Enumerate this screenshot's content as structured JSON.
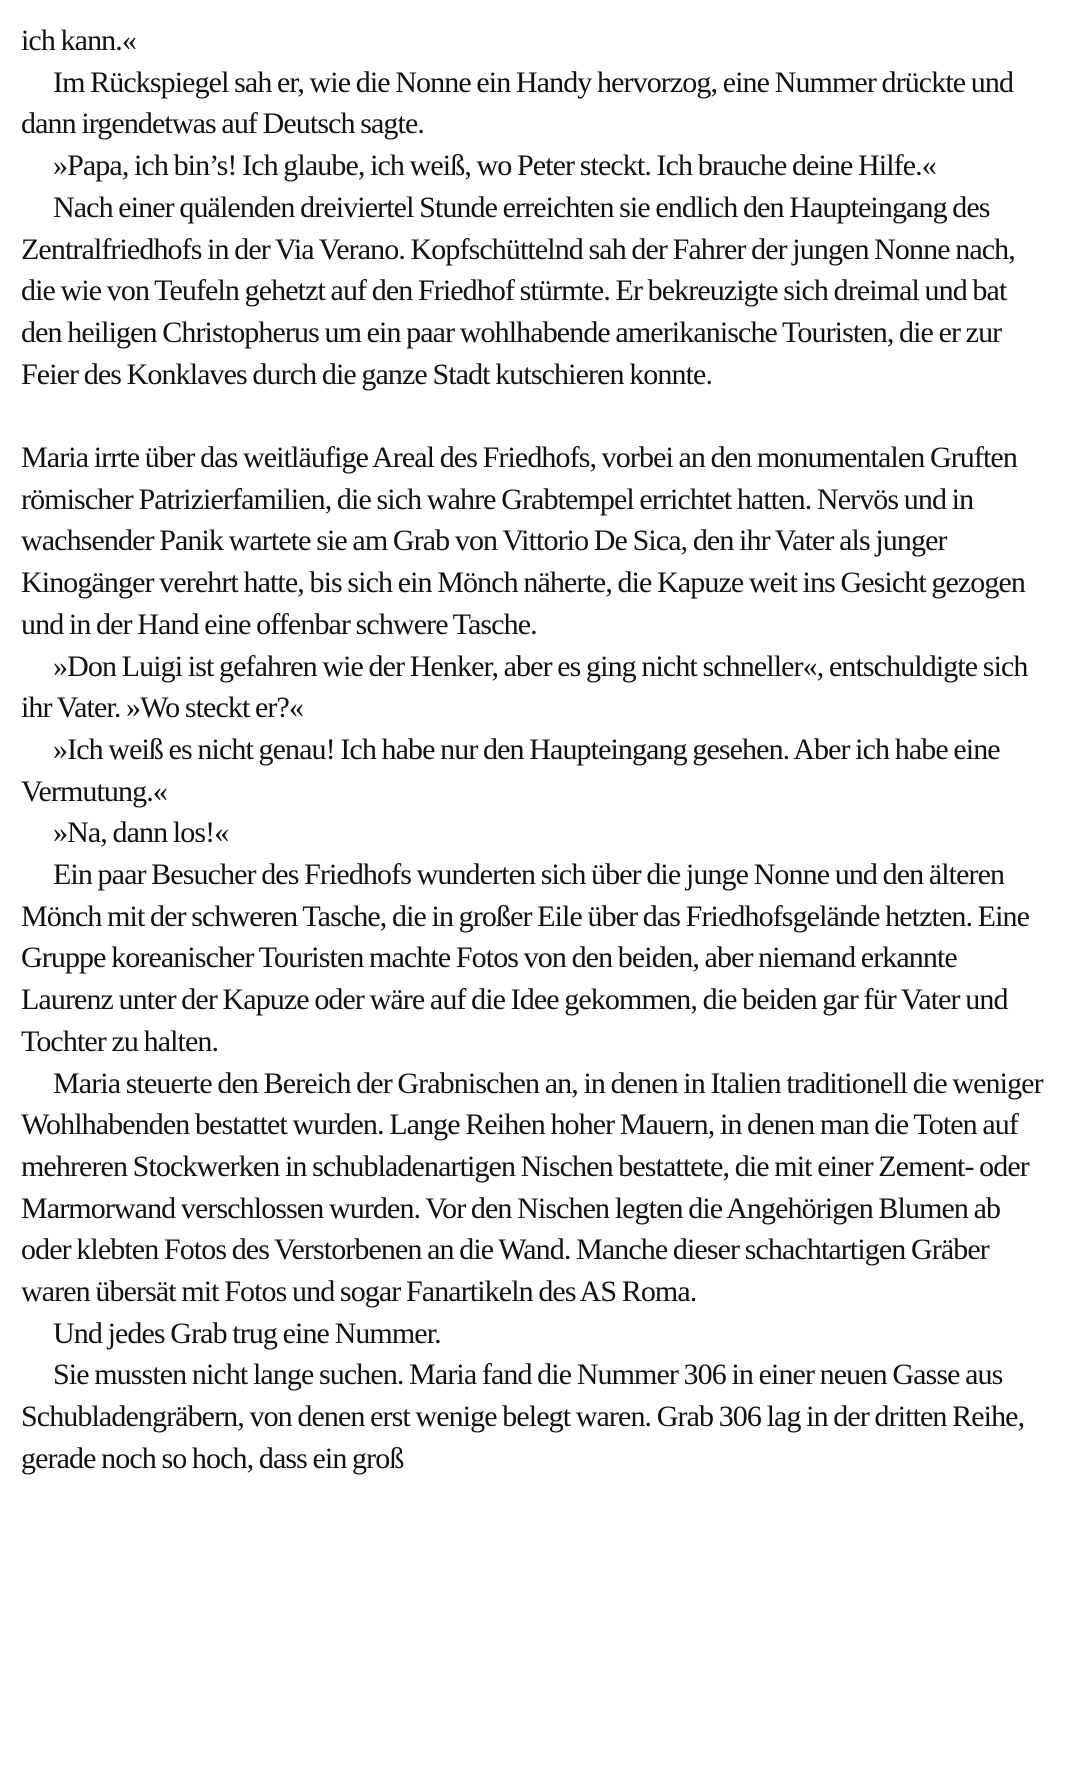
{
  "paragraphs": [
    {
      "indent": false,
      "gap_before": false,
      "text": "ich kann.«"
    },
    {
      "indent": true,
      "gap_before": false,
      "text": "Im Rückspiegel sah er, wie die Nonne ein Handy hervorzog, eine Nummer drückte und dann irgendetwas auf Deutsch sagte."
    },
    {
      "indent": true,
      "gap_before": false,
      "text": "»Papa, ich bin’s! Ich glaube, ich weiß, wo Peter steckt. Ich brauche deine Hilfe.«"
    },
    {
      "indent": true,
      "gap_before": false,
      "text": "Nach einer quälenden dreiviertel Stunde erreichten sie endlich den Haupteingang des Zentralfriedhofs in der Via Verano. Kopfschüttelnd sah der Fahrer der jungen Nonne nach, die wie von Teufeln gehetzt auf den Friedhof stürmte. Er bekreuzigte sich dreimal und bat den heiligen Christopherus um ein paar wohlhabende amerikanische Touristen, die er zur Feier des Konklaves durch die ganze Stadt kutschieren konnte."
    },
    {
      "indent": false,
      "gap_before": true,
      "text": "Maria irrte über das weitläufige Areal des Friedhofs, vorbei an den monumentalen Gruften römischer Patrizierfamilien, die sich wahre Grabtempel errichtet hatten. Nervös und in wachsender Panik wartete sie am Grab von Vittorio De Sica, den ihr Vater als junger Kinogänger verehrt hatte, bis sich ein Mönch näherte, die Kapuze weit ins Gesicht gezogen und in der Hand eine offenbar schwere Tasche."
    },
    {
      "indent": true,
      "gap_before": false,
      "text": "»Don Luigi ist gefahren wie der Henker, aber es ging nicht schneller«, entschuldigte sich ihr Vater. »Wo steckt er?«"
    },
    {
      "indent": true,
      "gap_before": false,
      "text": "»Ich weiß es nicht genau! Ich habe nur den Haupteingang gesehen. Aber ich habe eine Vermutung.«"
    },
    {
      "indent": true,
      "gap_before": false,
      "text": "»Na, dann los!«"
    },
    {
      "indent": true,
      "gap_before": false,
      "text": "Ein paar Besucher des Friedhofs wunderten sich über die junge Nonne und den älteren Mönch mit der schweren Tasche, die in großer Eile über das Friedhofsgelände hetzten. Eine Gruppe koreanischer Touristen machte Fotos von den beiden, aber niemand erkannte Laurenz unter der Kapuze oder wäre auf die Idee gekommen, die beiden gar für Vater und Tochter zu halten."
    },
    {
      "indent": true,
      "gap_before": false,
      "text": "Maria steuerte den Bereich der Grabnischen an, in denen in Italien traditionell die weniger Wohlhabenden bestattet wurden. Lange Reihen hoher Mauern, in denen man die Toten auf mehreren Stockwerken in schubladenartigen Nischen bestattete, die mit einer Zement- oder Marmorwand verschlossen wurden. Vor den Nischen legten die Angehörigen Blumen ab oder klebten Fotos des Verstorbenen an die Wand. Manche dieser schachtartigen Gräber waren übersät mit Fotos und sogar Fanartikeln des AS Roma."
    },
    {
      "indent": true,
      "gap_before": false,
      "text": "Und jedes Grab trug eine Nummer."
    },
    {
      "indent": true,
      "gap_before": false,
      "text": "Sie mussten nicht lange suchen. Maria fand die Nummer 306 in einer neuen Gasse aus Schubladengräbern, von denen erst wenige belegt waren. Grab 306 lag in der dritten Reihe, gerade noch so hoch, dass ein groß"
    }
  ]
}
